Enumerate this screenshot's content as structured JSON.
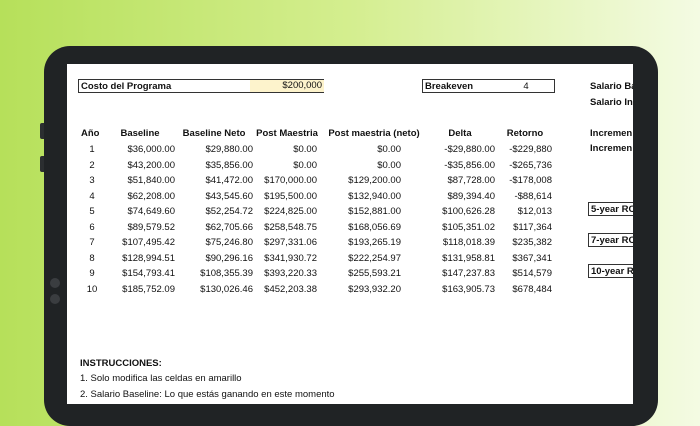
{
  "inputs": {
    "cost_label": "Costo del Programa",
    "cost_value": "$200,000",
    "breakeven_label": "Breakeven",
    "breakeven_value": "4",
    "salary_base_label": "Salario Ba",
    "salary_inc_label": "Salario In"
  },
  "table": {
    "headers": [
      "Año",
      "Baseline",
      "Baseline Neto",
      "Post Maestria",
      "Post maestria (neto)",
      "Delta",
      "Retorno"
    ],
    "rows": [
      [
        "1",
        "$36,000.00",
        "$29,880.00",
        "$0.00",
        "$0.00",
        "-$29,880.00",
        "-$229,880"
      ],
      [
        "2",
        "$43,200.00",
        "$35,856.00",
        "$0.00",
        "$0.00",
        "-$35,856.00",
        "-$265,736"
      ],
      [
        "3",
        "$51,840.00",
        "$41,472.00",
        "$170,000.00",
        "$129,200.00",
        "$87,728.00",
        "-$178,008"
      ],
      [
        "4",
        "$62,208.00",
        "$43,545.60",
        "$195,500.00",
        "$132,940.00",
        "$89,394.40",
        "-$88,614"
      ],
      [
        "5",
        "$74,649.60",
        "$52,254.72",
        "$224,825.00",
        "$152,881.00",
        "$100,626.28",
        "$12,013"
      ],
      [
        "6",
        "$89,579.52",
        "$62,705.66",
        "$258,548.75",
        "$168,056.69",
        "$105,351.02",
        "$117,364"
      ],
      [
        "7",
        "$107,495.42",
        "$75,246.80",
        "$297,331.06",
        "$193,265.19",
        "$118,018.39",
        "$235,382"
      ],
      [
        "8",
        "$128,994.51",
        "$90,296.16",
        "$341,930.72",
        "$222,254.97",
        "$131,958.81",
        "$367,341"
      ],
      [
        "9",
        "$154,793.41",
        "$108,355.39",
        "$393,220.33",
        "$255,593.21",
        "$147,237.83",
        "$514,579"
      ],
      [
        "10",
        "$185,752.09",
        "$130,026.46",
        "$452,203.38",
        "$293,932.20",
        "$163,905.73",
        "$678,484"
      ]
    ]
  },
  "side": {
    "increment_header": "Incremen",
    "increment_row": "Incremen",
    "roi5": "5-year RO",
    "roi7": "7-year RO",
    "roi10": "10-year R"
  },
  "instructions": {
    "title": "INSTRUCCIONES:",
    "items": [
      "1. Solo modifica las celdas en amarillo",
      "2. Salario Baseline: Lo que estás ganando en este momento"
    ]
  }
}
